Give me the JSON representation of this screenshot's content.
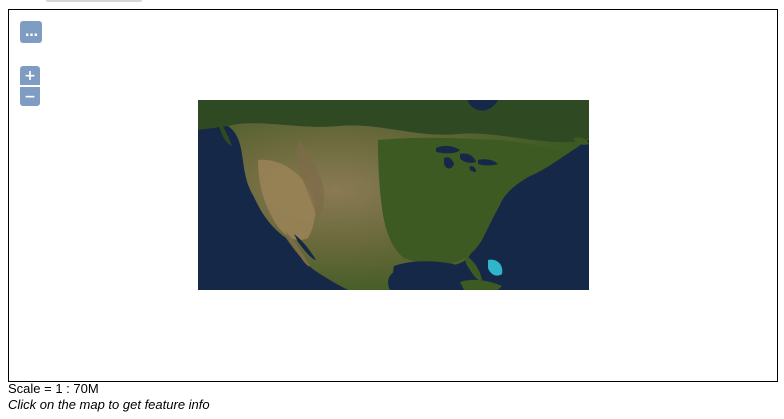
{
  "map": {
    "menu_icon": "…",
    "zoom_in_label": "+",
    "zoom_out_label": "−",
    "imagery": "satellite view of North America (United States, southern Canada, Mexico, Caribbean)"
  },
  "footer": {
    "scale_text": "Scale = 1 : 70M",
    "info_text": "Click on the map to get feature info"
  },
  "colors": {
    "control_bg": "rgba(0,60,136,0.5)",
    "ocean": "#162848",
    "land_green": "#3d5a22",
    "land_desert": "#8c7a52",
    "shallow_water": "#2fb6c8"
  }
}
